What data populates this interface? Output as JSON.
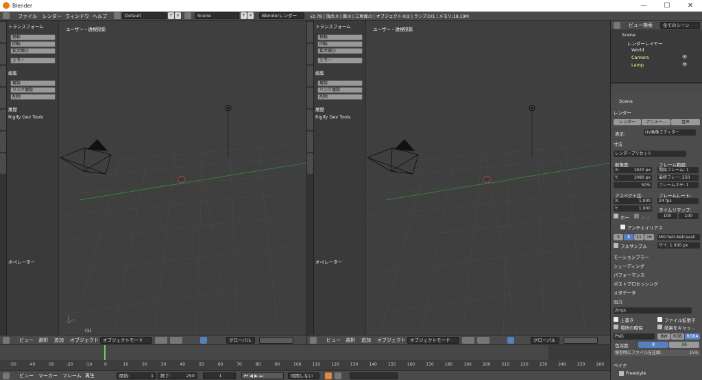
{
  "window": {
    "title": "Blender",
    "min": "—",
    "max": "☐",
    "close": "✕"
  },
  "info_header": {
    "menus": [
      "ファイル",
      "レンダー",
      "ウィンドウ",
      "ヘルプ"
    ],
    "layout": "Default",
    "scene": "Scene",
    "engine": "Blenderレンダー",
    "stats": "v2.78 | 頂点:0 | 面:0 | 三角面:0 | オブジェクト:0/2 | ランプ:0/1 | メモリ:18.19M"
  },
  "tool_shelf": {
    "transform": "トランスフォーム",
    "move": "移動",
    "rotate": "回転",
    "scale": "拡大縮小",
    "mirror": "ミラー",
    "edit": "編集",
    "duplicate": "複製",
    "linked_dup": "リンク複製",
    "delete": "削除",
    "history": "履歴",
    "rigify": "Rigify Dev Tools",
    "operator": "オペレーター"
  },
  "viewport": {
    "label": "ユーザー・透視投影",
    "frame": "(1)"
  },
  "view3d_header": {
    "menus": [
      "ビュー",
      "選択",
      "追加",
      "オブジェクト"
    ],
    "mode": "オブジェクトモード",
    "orientation": "グローバル"
  },
  "timeline": {
    "ticks_left": [
      "-50",
      "-40",
      "-30",
      "-20",
      "-10",
      "0",
      "10",
      "20",
      "30",
      "40",
      "50",
      "60",
      "70",
      "80",
      "90",
      "100",
      "110",
      "120",
      "130",
      "140",
      "150",
      "160",
      "170",
      "180",
      "190",
      "200",
      "210",
      "220",
      "230",
      "240",
      "250",
      "260"
    ],
    "menus": [
      "ビュー",
      "マーカー",
      "フレーム",
      "再生"
    ],
    "start_label": "開始:",
    "start": "1",
    "end_label": "終了:",
    "end": "250",
    "current": "1",
    "sync": "同期しない"
  },
  "outliner": {
    "view": "ビュー",
    "search": "検索",
    "filter": "全てのシーン",
    "items": [
      "Scene",
      "レンダーレイヤー",
      "World",
      "Camera",
      "Lamp"
    ]
  },
  "properties": {
    "scene": "Scene",
    "render_panel": "レンダー",
    "render_btn": "レンダー",
    "anim_btn": "アニメー...",
    "audio_btn": "音声",
    "display_label": "表示:",
    "display_value": "UV画像エディター",
    "dimensions": "寸法",
    "presets": "レンダープリセット",
    "resolution": "解像度:",
    "res_x": "X:",
    "res_x_val": "1920 px",
    "res_y": "Y:",
    "res_y_val": "1080 px",
    "res_pct": "50%",
    "frame_range": "フレーム範囲:",
    "frame_start": "開始フレーム: 1",
    "frame_end": "最終フレー: 250",
    "frame_step": "フレームステ: 1",
    "aspect": "アスペクト比:",
    "asp_x": "X:",
    "asp_x_val": "1.000",
    "asp_y": "Y:",
    "asp_y_val": "1.000",
    "framerate": "フレームレート:",
    "fps": "24 fps",
    "remap": "タイムリマップ:",
    "remap_old": "100",
    "remap_new": "100",
    "border": "ボー",
    "crop": "トリ",
    "aa": "アンチエイリアス",
    "aa_5": "5",
    "aa_8": "8",
    "aa_11": "11",
    "aa_16": "16",
    "filter": "Mitchell-Netravali",
    "full_sample": "フルサンプル",
    "size": "サイ: 1.000 px",
    "motion_blur": "モーションブラー",
    "shading": "シェーディング",
    "performance": "パフォーマンス",
    "post": "ポストプロセッシング",
    "metadata": "メタデータ",
    "output": "出力",
    "path": "/tmp\\",
    "overwrite": "上書き",
    "ext": "ファイル拡張子",
    "placeholders": "場所の確保",
    "cache": "結果をキャッ...",
    "format": "PNG",
    "bw": "BW",
    "rgb": "RGB",
    "rgba": "RGBA",
    "depth": "色深度:",
    "d8": "8",
    "d16": "16",
    "compress_label": "保存時にファイルを圧縮:",
    "compress": "15%",
    "bake": "ベイク",
    "freestyle": "Freestyle"
  }
}
